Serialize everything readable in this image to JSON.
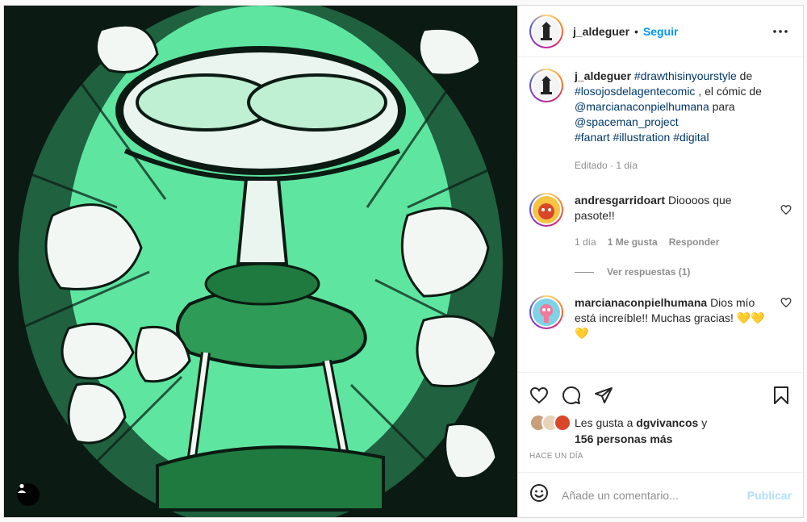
{
  "post": {
    "username": "j_aldeguer",
    "separator": "•",
    "follow_label": "Seguir"
  },
  "caption": {
    "username": "j_aldeguer",
    "tag1": "#drawthisinyourstyle",
    "t1": " de ",
    "tag2": "#losojosdelagentecomic",
    "t2": " , el cómic de ",
    "mention1": "@marcianaconpielhumana",
    "t3": " para ",
    "mention2": "@spaceman_project",
    "tag3": "#fanart",
    "tag4": "#illustration",
    "tag5": "#digital",
    "meta": "Editado · 1 día"
  },
  "comments": [
    {
      "username": "andresgarridoart",
      "text": "Dioooos que pasote!!",
      "time": "1 día",
      "likes": "1 Me gusta",
      "reply": "Responder",
      "view_replies": "Ver respuestas (1)"
    },
    {
      "username": "marcianaconpielhumana",
      "text": "Dios mío está increíble!! Muchas gracias! 💛💛💛"
    }
  ],
  "likes": {
    "prefix": "Les gusta a ",
    "user": "dgvivancos",
    "middle": " y",
    "others": "156 personas más"
  },
  "timestamp": "Hace un día",
  "comment_box": {
    "placeholder": "Añade un comentario...",
    "publish_label": "Publicar"
  },
  "colors": {
    "accent_blue": "#0095f6",
    "tag_blue": "#00376b",
    "publish_disabled": "#b2dffc",
    "art_green": "#5ee6a1",
    "art_dark_green": "#1f7a3f"
  },
  "icons": [
    "more-options-icon",
    "heart-icon",
    "comment-icon",
    "share-icon",
    "bookmark-icon",
    "emoji-icon",
    "user-tag-icon"
  ]
}
